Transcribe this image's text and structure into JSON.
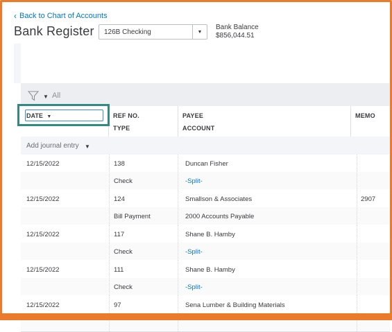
{
  "nav": {
    "back_label": "Back to Chart of Accounts"
  },
  "page": {
    "title": "Bank Register"
  },
  "account_select": {
    "value": "126B Checking"
  },
  "balance": {
    "label": "Bank Balance",
    "amount": "$856,044.51"
  },
  "filter": {
    "label": "All"
  },
  "columns": {
    "date": "DATE",
    "ref_no": "REF NO.",
    "type": "TYPE",
    "payee": "PAYEE",
    "account": "ACCOUNT",
    "memo": "MEMO"
  },
  "add_entry": {
    "label": "Add journal entry"
  },
  "transactions": [
    {
      "date": "12/15/2022",
      "ref_no": "138",
      "type": "Check",
      "payee": "Duncan Fisher",
      "account": "-Split-",
      "memo": ""
    },
    {
      "date": "12/15/2022",
      "ref_no": "124",
      "type": "Bill Payment",
      "payee": "Smallson & Associates",
      "account": "2000 Accounts Payable",
      "memo": "2907"
    },
    {
      "date": "12/15/2022",
      "ref_no": "117",
      "type": "Check",
      "payee": "Shane B. Hamby",
      "account": "-Split-",
      "memo": ""
    },
    {
      "date": "12/15/2022",
      "ref_no": "111",
      "type": "Check",
      "payee": "Shane B. Hamby",
      "account": "-Split-",
      "memo": ""
    },
    {
      "date": "12/15/2022",
      "ref_no": "97",
      "type": "",
      "payee": "Sena Lumber & Building Materials",
      "account": "",
      "memo": ""
    }
  ]
}
